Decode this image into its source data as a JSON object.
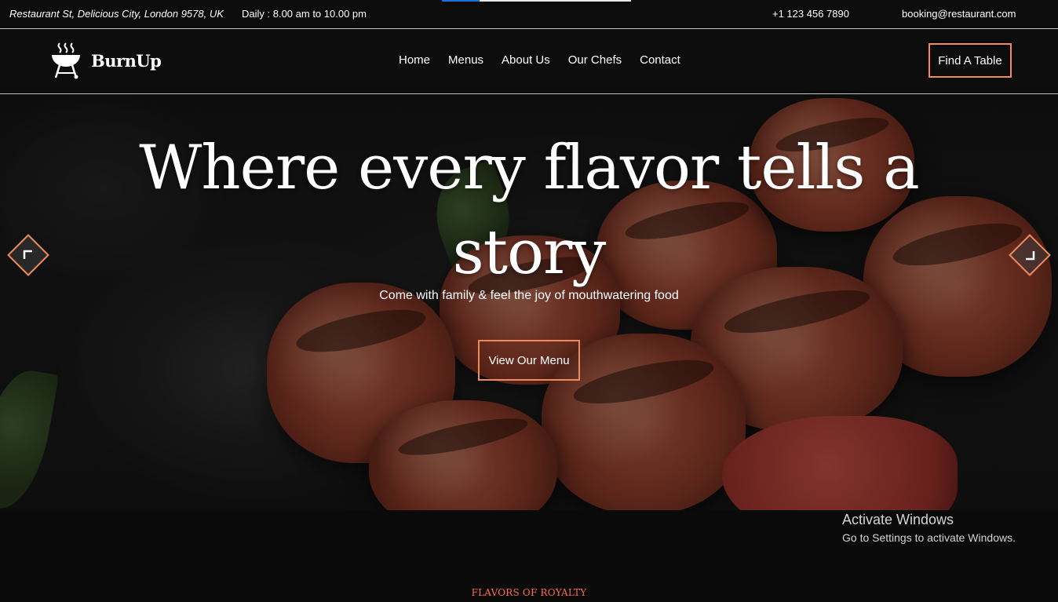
{
  "topbar": {
    "address": "Restaurant St, Delicious City, London 9578, UK",
    "hours": "Daily : 8.00 am to 10.00 pm",
    "phone": "+1 123 456 7890",
    "email": "booking@restaurant.com"
  },
  "brand": {
    "name": "BurnUp",
    "logo_icon": "barbecue-grill-icon",
    "accent_color": "#f08a5d"
  },
  "nav": {
    "items": [
      {
        "label": "Home"
      },
      {
        "label": "Menus"
      },
      {
        "label": "About Us"
      },
      {
        "label": "Our Chefs"
      },
      {
        "label": "Contact"
      }
    ],
    "cta_label": "Find A Table"
  },
  "hero": {
    "title": "Where every flavor tells a story",
    "subtitle": "Come with family & feel the joy of mouthwatering food",
    "button_label": "View Our Menu",
    "prev_icon": "arrow-left-icon",
    "next_icon": "arrow-right-icon"
  },
  "os_notice": {
    "title": "Activate Windows",
    "subtitle": "Go to Settings to activate Windows."
  },
  "section": {
    "tag": "FLAVORS OF ROYALTY",
    "tag_color": "#ff6b47"
  }
}
